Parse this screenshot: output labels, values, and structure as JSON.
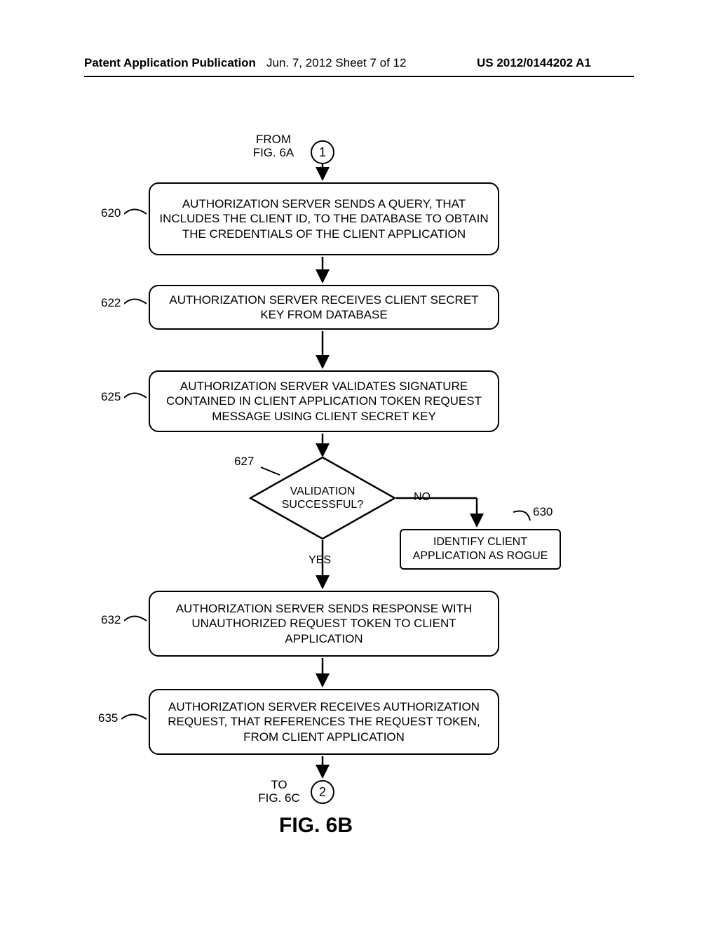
{
  "header": {
    "left": "Patent Application Publication",
    "mid": "Jun. 7, 2012  Sheet 7 of 12",
    "right": "US 2012/0144202 A1"
  },
  "from": {
    "label": "FROM\nFIG. 6A",
    "connector": "1"
  },
  "to": {
    "label": "TO\nFIG. 6C",
    "connector": "2"
  },
  "steps": {
    "s620": {
      "ref": "620",
      "text": "AUTHORIZATION SERVER SENDS A QUERY, THAT INCLUDES THE CLIENT ID, TO THE DATABASE TO OBTAIN THE CREDENTIALS OF THE CLIENT APPLICATION"
    },
    "s622": {
      "ref": "622",
      "text": "AUTHORIZATION SERVER RECEIVES CLIENT SECRET KEY FROM DATABASE"
    },
    "s625": {
      "ref": "625",
      "text": "AUTHORIZATION SERVER VALIDATES SIGNATURE CONTAINED IN CLIENT APPLICATION TOKEN REQUEST MESSAGE USING CLIENT SECRET KEY"
    },
    "s627": {
      "ref": "627",
      "text": "VALIDATION SUCCESSFUL?"
    },
    "s630": {
      "ref": "630",
      "text": "IDENTIFY CLIENT APPLICATION AS ROGUE"
    },
    "s632": {
      "ref": "632",
      "text": "AUTHORIZATION SERVER SENDS RESPONSE WITH UNAUTHORIZED REQUEST TOKEN TO CLIENT APPLICATION"
    },
    "s635": {
      "ref": "635",
      "text": "AUTHORIZATION SERVER RECEIVES AUTHORIZATION REQUEST, THAT REFERENCES THE REQUEST TOKEN, FROM CLIENT APPLICATION"
    }
  },
  "edges": {
    "yes": "YES",
    "no": "NO"
  },
  "figure_title": "FIG. 6B"
}
